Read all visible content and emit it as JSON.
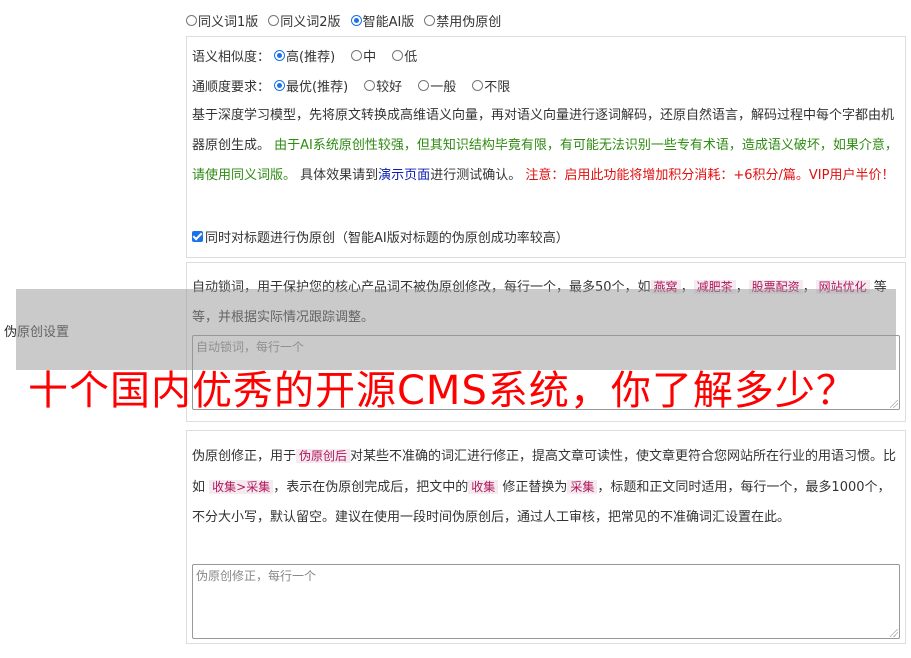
{
  "mode": {
    "options": [
      "同义词1版",
      "同义词2版",
      "智能AI版",
      "禁用伪原创"
    ],
    "selected": 2
  },
  "side_label": "伪原创设置",
  "similarity": {
    "label": "语义相似度：",
    "options": [
      "高(推荐)",
      "中",
      "低"
    ],
    "selected": 0
  },
  "fluency": {
    "label": "通顺度要求：",
    "options": [
      "最优(推荐)",
      "较好",
      "一般",
      "不限"
    ],
    "selected": 0
  },
  "ai_desc": {
    "part1": "基于深度学习模型，先将原文转换成高维语义向量，再对语义向量进行逐词解码，还原自然语言，解码过程中每个字都由机器原创生成。",
    "part2_green": "由于AI系统原创性较强，但其知识结构毕竟有限，有可能无法识别一些专有术语，造成语义破坏，如果介意，请使用同义词版。",
    "part3": "具体效果请到",
    "demo_link": "演示页面",
    "part4": "进行测试确认。",
    "notice_red": "注意：启用此功能将增加积分消耗：+6积分/篇。VIP用户半价！"
  },
  "title_checkbox": {
    "label": "同时对标题进行伪原创（智能AI版对标题的伪原创成功率较高）",
    "checked": true
  },
  "lock": {
    "desc1": "自动锁词，用于保护您的核心产品词不被伪原创修改，每行一个，最多50个，如",
    "examples": [
      "燕窝",
      "减肥茶",
      "股票配资",
      "网站优化"
    ],
    "desc2": "等等，并根据实际情况跟踪调整。",
    "placeholder": "自动锁词，每行一个"
  },
  "fix": {
    "d1": "伪原创修正，用于",
    "kw1": "伪原创后",
    "d2": "对某些不准确的词汇进行修正，提高文章可读性，使文章更符合您网站所在行业的用语习惯。比如",
    "kw2": "收集>采集",
    "d3": "，表示在伪原创完成后，把文中的",
    "kw3": "收集",
    "d4": "修正替换为",
    "kw4": "采集",
    "d5": "，标题和正文同时适用，每行一个，最多1000个，不分大小写，默认留空。建议在使用一段时间伪原创后，通过人工审核，把常见的不准确词汇设置在此。",
    "placeholder": "伪原创修正，每行一个"
  },
  "banner": "十个国内优秀的开源CMS系统，你了解多少？",
  "colors": {
    "accent": "#1a73e8",
    "green": "#2e8b12",
    "red": "#e01010",
    "link": "#0b20b0",
    "banner": "#ff0000"
  }
}
